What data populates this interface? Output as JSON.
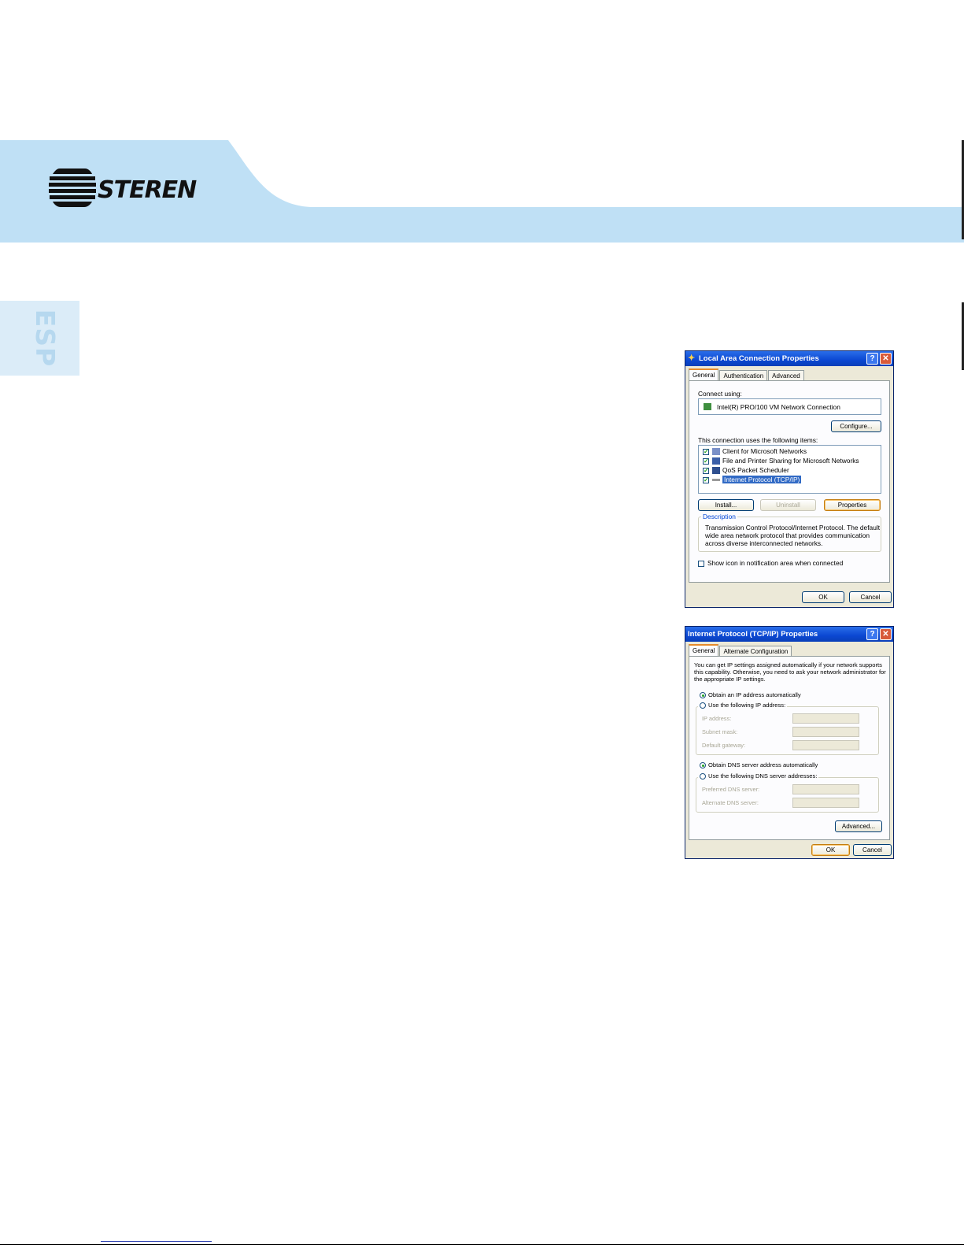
{
  "brand": {
    "logo_text": "STEREN",
    "language_tab": "ESP"
  },
  "colors": {
    "header_band": "#bfe0f5",
    "side_tab": "#dbecf8",
    "xp_title": "#0b47d2",
    "xp_face": "#ece9d8"
  },
  "dialog1": {
    "title": "Local Area Connection Properties",
    "tabs": [
      "General",
      "Authentication",
      "Advanced"
    ],
    "connect_using_label": "Connect using:",
    "adapter": "Intel(R) PRO/100 VM Network Connection",
    "configure_button": "Configure...",
    "items_label": "This connection uses the following items:",
    "items": [
      "Client for Microsoft Networks",
      "File and Printer Sharing for Microsoft Networks",
      "QoS Packet Scheduler",
      "Internet Protocol (TCP/IP)"
    ],
    "install_button": "Install...",
    "uninstall_button": "Uninstall",
    "properties_button": "Properties",
    "description_legend": "Description",
    "description_lines": [
      "Transmission Control Protocol/Internet Protocol. The default",
      "wide area network protocol that provides communication",
      "across diverse interconnected networks."
    ],
    "show_icon_label": "Show icon in notification area when connected",
    "ok_button": "OK",
    "cancel_button": "Cancel"
  },
  "dialog2": {
    "title": "Internet Protocol (TCP/IP) Properties",
    "tabs": [
      "General",
      "Alternate Configuration"
    ],
    "intro_lines": [
      "You can get IP settings assigned automatically if your network supports",
      "this capability. Otherwise, you need to ask your network administrator for",
      "the appropriate IP settings."
    ],
    "obtain_ip_label": "Obtain an IP address automatically",
    "use_ip_label": "Use the following IP address:",
    "ip_address_label": "IP address:",
    "subnet_mask_label": "Subnet mask:",
    "default_gateway_label": "Default gateway:",
    "obtain_dns_label": "Obtain DNS server address automatically",
    "use_dns_label": "Use the following DNS server addresses:",
    "preferred_dns_label": "Preferred DNS server:",
    "alternate_dns_label": "Alternate DNS server:",
    "advanced_button": "Advanced...",
    "ok_button": "OK",
    "cancel_button": "Cancel"
  }
}
